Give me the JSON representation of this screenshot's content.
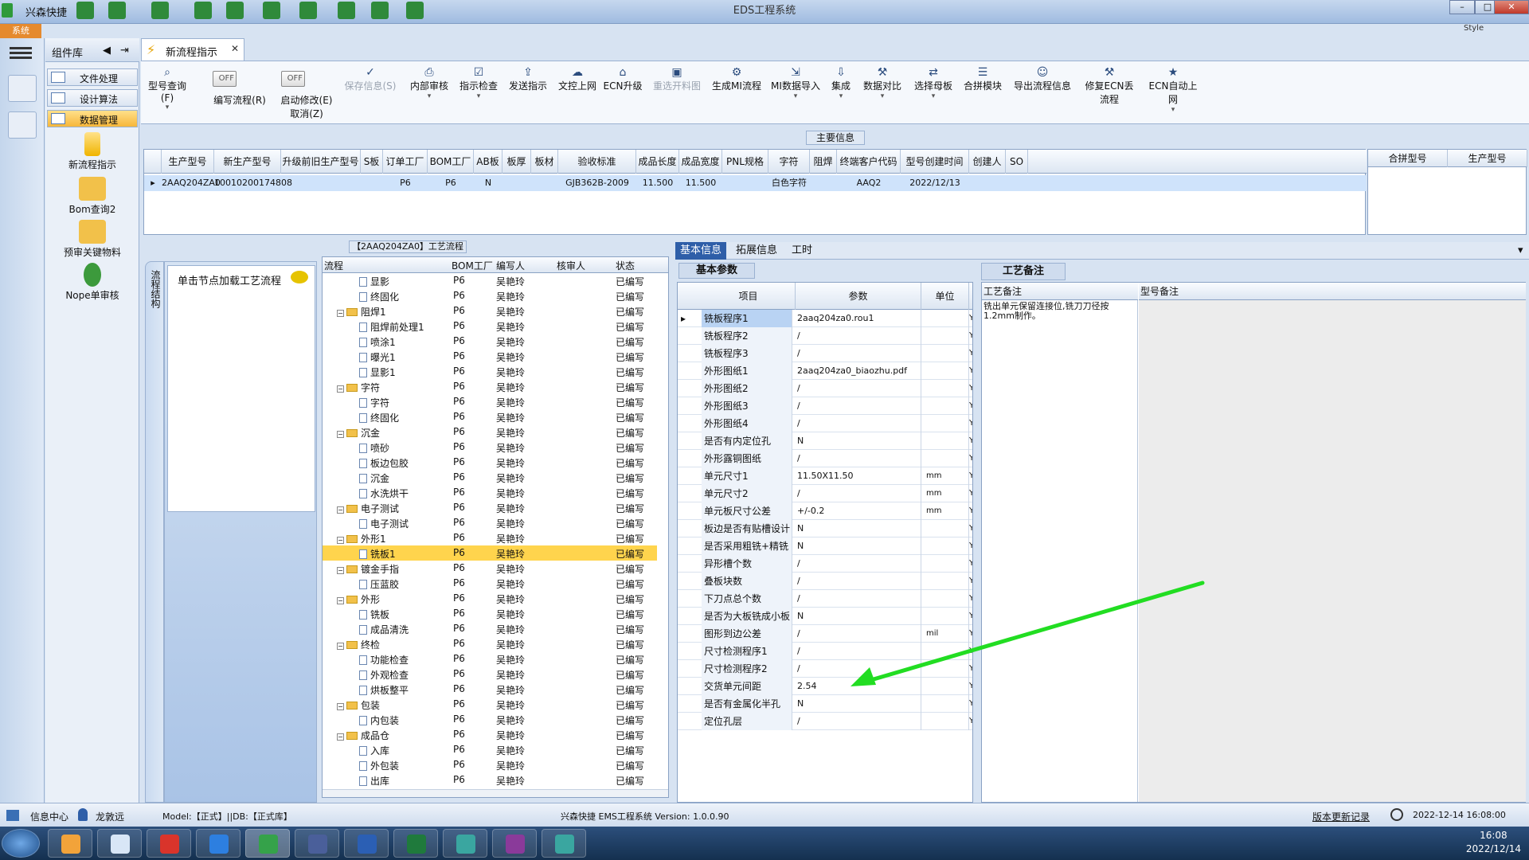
{
  "window": {
    "app_label": "兴森快捷",
    "title": "EDS工程系统",
    "system_tab": "系统",
    "style_label": "Style"
  },
  "sidebar": {
    "header": "组件库",
    "items": [
      {
        "label": "文件处理"
      },
      {
        "label": "设计算法"
      },
      {
        "label": "数据管理"
      }
    ],
    "tools": [
      {
        "label": "新流程指示"
      },
      {
        "label": "Bom查询2"
      },
      {
        "label": "预审关键物料"
      },
      {
        "label": "Nope单审核"
      }
    ]
  },
  "main_tab": {
    "label": "新流程指示"
  },
  "toolbar": {
    "buttons": [
      {
        "label": "型号查询(F)"
      },
      {
        "label": "编写流程(R)",
        "toggle": "OFF"
      },
      {
        "label": "启动修改(E)",
        "sub": "取消(Z)",
        "toggle": "OFF"
      },
      {
        "label": "保存信息(S)"
      },
      {
        "label": "内部审核"
      },
      {
        "label": "指示检查"
      },
      {
        "label": "发送指示"
      },
      {
        "label": "文控上网"
      },
      {
        "label": "ECN升级"
      },
      {
        "label": "重选开料图"
      },
      {
        "label": "生成MI流程"
      },
      {
        "label": "MI数据导入"
      },
      {
        "label": "集成"
      },
      {
        "label": "数据对比"
      },
      {
        "label": "选择母板"
      },
      {
        "label": "合拼模块"
      },
      {
        "label": "导出流程信息"
      },
      {
        "label": "修复ECN丢流程"
      },
      {
        "label": "ECN自动上网"
      }
    ]
  },
  "main_info": {
    "label": "主要信息",
    "columns": [
      "生产型号",
      "新生产型号",
      "升级前旧生产型号",
      "S板",
      "订单工厂",
      "BOM工厂",
      "AB板",
      "板厚",
      "板材",
      "验收标准",
      "成品长度",
      "成品宽度",
      "PNL规格",
      "字符",
      "阻焊",
      "终端客户代码",
      "型号创建时间",
      "创建人",
      "SO"
    ],
    "row": [
      "2AAQ204ZA0",
      "10010200174808",
      "",
      "",
      "P6",
      "P6",
      "N",
      "",
      "",
      "GJB362B-2009",
      "11.500",
      "11.500",
      "",
      "白色字符",
      "",
      "AAQ2",
      "2022/12/13",
      "",
      ""
    ],
    "side_columns": [
      "合拼型号",
      "生产型号"
    ]
  },
  "process": {
    "label": "【2AAQ204ZA0】工艺流程",
    "vertical_tab": "流程结构",
    "hint": "单击节点加载工艺流程",
    "columns": [
      "流程",
      "BOM工厂",
      "编写人",
      "核审人",
      "状态"
    ],
    "rows": [
      {
        "name": "显影",
        "type": "doc",
        "level": 2,
        "factory": "P6",
        "writer": "吴艳玲",
        "status": "已编写"
      },
      {
        "name": "终固化",
        "type": "doc",
        "level": 2,
        "factory": "P6",
        "writer": "吴艳玲",
        "status": "已编写"
      },
      {
        "name": "阻焊1",
        "type": "folder",
        "level": 1,
        "factory": "P6",
        "writer": "吴艳玲",
        "status": "已编写"
      },
      {
        "name": "阻焊前处理1",
        "type": "doc",
        "level": 2,
        "factory": "P6",
        "writer": "吴艳玲",
        "status": "已编写"
      },
      {
        "name": "喷涂1",
        "type": "doc",
        "level": 2,
        "factory": "P6",
        "writer": "吴艳玲",
        "status": "已编写"
      },
      {
        "name": "曝光1",
        "type": "doc",
        "level": 2,
        "factory": "P6",
        "writer": "吴艳玲",
        "status": "已编写"
      },
      {
        "name": "显影1",
        "type": "doc",
        "level": 2,
        "factory": "P6",
        "writer": "吴艳玲",
        "status": "已编写"
      },
      {
        "name": "字符",
        "type": "folder",
        "level": 1,
        "factory": "P6",
        "writer": "吴艳玲",
        "status": "已编写"
      },
      {
        "name": "字符",
        "type": "doc",
        "level": 2,
        "factory": "P6",
        "writer": "吴艳玲",
        "status": "已编写"
      },
      {
        "name": "终固化",
        "type": "doc",
        "level": 2,
        "factory": "P6",
        "writer": "吴艳玲",
        "status": "已编写"
      },
      {
        "name": "沉金",
        "type": "folder",
        "level": 1,
        "factory": "P6",
        "writer": "吴艳玲",
        "status": "已编写"
      },
      {
        "name": "喷砂",
        "type": "doc",
        "level": 2,
        "factory": "P6",
        "writer": "吴艳玲",
        "status": "已编写"
      },
      {
        "name": "板边包胶",
        "type": "doc",
        "level": 2,
        "factory": "P6",
        "writer": "吴艳玲",
        "status": "已编写"
      },
      {
        "name": "沉金",
        "type": "doc",
        "level": 2,
        "factory": "P6",
        "writer": "吴艳玲",
        "status": "已编写"
      },
      {
        "name": "水洗烘干",
        "type": "doc",
        "level": 2,
        "factory": "P6",
        "writer": "吴艳玲",
        "status": "已编写"
      },
      {
        "name": "电子测试",
        "type": "folder",
        "level": 1,
        "factory": "P6",
        "writer": "吴艳玲",
        "status": "已编写"
      },
      {
        "name": "电子测试",
        "type": "doc",
        "level": 2,
        "factory": "P6",
        "writer": "吴艳玲",
        "status": "已编写"
      },
      {
        "name": "外形1",
        "type": "folder",
        "level": 1,
        "factory": "P6",
        "writer": "吴艳玲",
        "status": "已编写"
      },
      {
        "name": "铣板1",
        "type": "doc",
        "level": 2,
        "factory": "P6",
        "writer": "吴艳玲",
        "status": "已编写",
        "selected": true
      },
      {
        "name": "镀金手指",
        "type": "folder",
        "level": 1,
        "factory": "P6",
        "writer": "吴艳玲",
        "status": "已编写"
      },
      {
        "name": "压蓝胶",
        "type": "doc",
        "level": 2,
        "factory": "P6",
        "writer": "吴艳玲",
        "status": "已编写"
      },
      {
        "name": "外形",
        "type": "folder",
        "level": 1,
        "factory": "P6",
        "writer": "吴艳玲",
        "status": "已编写"
      },
      {
        "name": "铣板",
        "type": "doc",
        "level": 2,
        "factory": "P6",
        "writer": "吴艳玲",
        "status": "已编写"
      },
      {
        "name": "成品清洗",
        "type": "doc",
        "level": 2,
        "factory": "P6",
        "writer": "吴艳玲",
        "status": "已编写"
      },
      {
        "name": "终检",
        "type": "folder",
        "level": 1,
        "factory": "P6",
        "writer": "吴艳玲",
        "status": "已编写"
      },
      {
        "name": "功能检查",
        "type": "doc",
        "level": 2,
        "factory": "P6",
        "writer": "吴艳玲",
        "status": "已编写"
      },
      {
        "name": "外观检查",
        "type": "doc",
        "level": 2,
        "factory": "P6",
        "writer": "吴艳玲",
        "status": "已编写"
      },
      {
        "name": "烘板整平",
        "type": "doc",
        "level": 2,
        "factory": "P6",
        "writer": "吴艳玲",
        "status": "已编写"
      },
      {
        "name": "包装",
        "type": "folder",
        "level": 1,
        "factory": "P6",
        "writer": "吴艳玲",
        "status": "已编写"
      },
      {
        "name": "内包装",
        "type": "doc",
        "level": 2,
        "factory": "P6",
        "writer": "吴艳玲",
        "status": "已编写"
      },
      {
        "name": "成品仓",
        "type": "folder",
        "level": 1,
        "factory": "P6",
        "writer": "吴艳玲",
        "status": "已编写"
      },
      {
        "name": "入库",
        "type": "doc",
        "level": 2,
        "factory": "P6",
        "writer": "吴艳玲",
        "status": "已编写"
      },
      {
        "name": "外包装",
        "type": "doc",
        "level": 2,
        "factory": "P6",
        "writer": "吴艳玲",
        "status": "已编写"
      },
      {
        "name": "出库",
        "type": "doc",
        "level": 2,
        "factory": "P6",
        "writer": "吴艳玲",
        "status": "已编写"
      }
    ]
  },
  "right_tabs": [
    "基本信息",
    "拓展信息",
    "工时"
  ],
  "basic": {
    "label": "基本参数",
    "columns": [
      "项目",
      "参数",
      "单位"
    ],
    "rows": [
      {
        "item": "铣板程序1",
        "param": "2aaq204za0.rou1",
        "unit": ""
      },
      {
        "item": "铣板程序2",
        "param": "/",
        "unit": ""
      },
      {
        "item": "铣板程序3",
        "param": "/",
        "unit": ""
      },
      {
        "item": "外形图纸1",
        "param": "2aaq204za0_biaozhu.pdf",
        "unit": ""
      },
      {
        "item": "外形图纸2",
        "param": "/",
        "unit": ""
      },
      {
        "item": "外形图纸3",
        "param": "/",
        "unit": ""
      },
      {
        "item": "外形图纸4",
        "param": "/",
        "unit": ""
      },
      {
        "item": "是否有内定位孔",
        "param": "N",
        "unit": ""
      },
      {
        "item": "外形露铜图纸",
        "param": "/",
        "unit": ""
      },
      {
        "item": "单元尺寸1",
        "param": "11.50X11.50",
        "unit": "mm"
      },
      {
        "item": "单元尺寸2",
        "param": "/",
        "unit": "mm"
      },
      {
        "item": "单元板尺寸公差",
        "param": "+/-0.2",
        "unit": "mm"
      },
      {
        "item": "板边是否有贴槽设计",
        "param": "N",
        "unit": ""
      },
      {
        "item": "是否采用粗铣+精铣",
        "param": "N",
        "unit": ""
      },
      {
        "item": "异形槽个数",
        "param": "/",
        "unit": ""
      },
      {
        "item": "叠板块数",
        "param": "/",
        "unit": ""
      },
      {
        "item": "下刀点总个数",
        "param": "/",
        "unit": ""
      },
      {
        "item": "是否为大板铣成小板",
        "param": "N",
        "unit": ""
      },
      {
        "item": "图形到边公差",
        "param": "/",
        "unit": "mil"
      },
      {
        "item": "尺寸检测程序1",
        "param": "/",
        "unit": ""
      },
      {
        "item": "尺寸检测程序2",
        "param": "/",
        "unit": ""
      },
      {
        "item": "交货单元间距",
        "param": "2.54",
        "unit": ""
      },
      {
        "item": "是否有金属化半孔",
        "param": "N",
        "unit": ""
      },
      {
        "item": "定位孔层",
        "param": "/",
        "unit": ""
      }
    ],
    "flag": "Y"
  },
  "notes": {
    "label": "工艺备注",
    "col1": "工艺备注",
    "col2": "型号备注",
    "text": "铣出单元保留连接位,铣刀刀径按1.2mm制作。"
  },
  "status": {
    "info_center": "信息中心",
    "user": "龙敦远",
    "model": "Model:【正式】||DB:【正式库】",
    "center": "兴森快捷 EMS工程系统 Version: 1.0.0.90",
    "version_log": "版本更新记录",
    "datetime": "2022-12-14 16:08:00"
  },
  "taskbar": {
    "time": "16:08",
    "date": "2022/12/14"
  },
  "colors": {
    "accent": "#2e5ea8",
    "selection": "#ffd44d",
    "arrow": "#22dd22"
  }
}
